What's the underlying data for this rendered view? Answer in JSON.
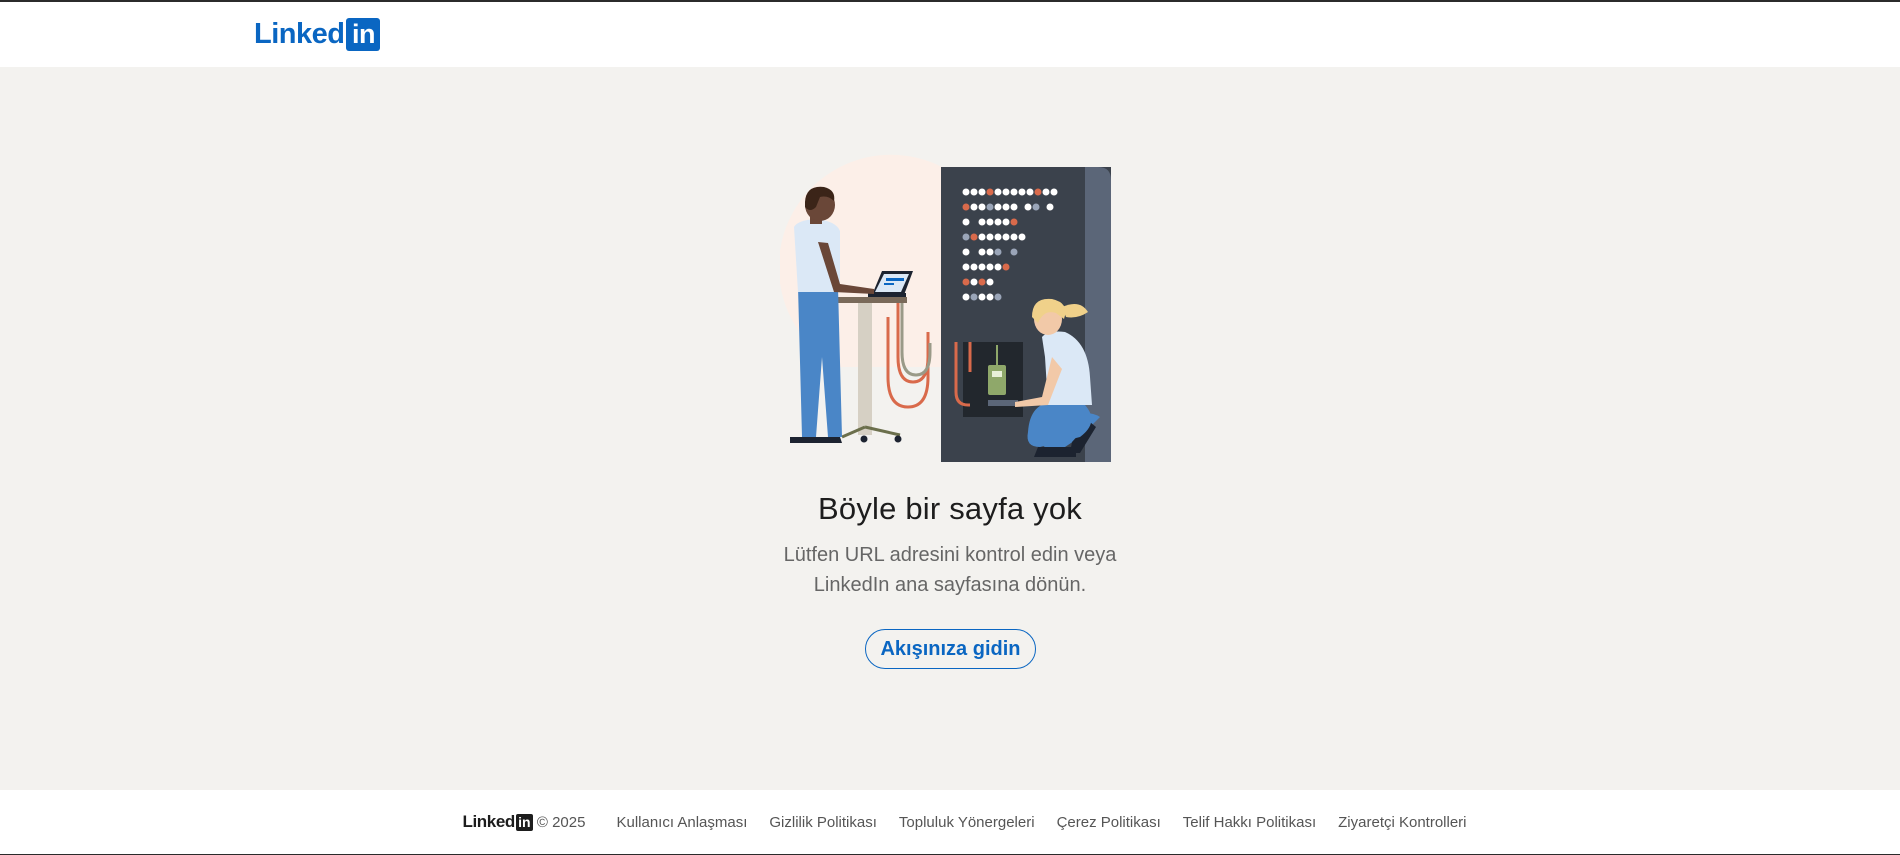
{
  "header": {
    "logo_word": "Linked",
    "logo_box": "in"
  },
  "main": {
    "title": "Böyle bir sayfa yok",
    "subtitle_line1": "Lütfen URL adresini kontrol edin veya",
    "subtitle_line2": "LinkedIn ana sayfasına dönün.",
    "cta_label": "Akışınıza gidin"
  },
  "footer": {
    "logo_word": "Linked",
    "logo_box": "in",
    "copyright": "© 2025",
    "links": [
      "Kullanıcı Anlaşması",
      "Gizlilik Politikası",
      "Topluluk Yönergeleri",
      "Çerez Politikası",
      "Telif Hakkı Politikası",
      "Ziyaretçi Kontrolleri"
    ]
  },
  "colors": {
    "brand": "#0a66c2",
    "background": "#f3f2ef"
  },
  "icons": {
    "illustration": "server-room-illustration"
  }
}
